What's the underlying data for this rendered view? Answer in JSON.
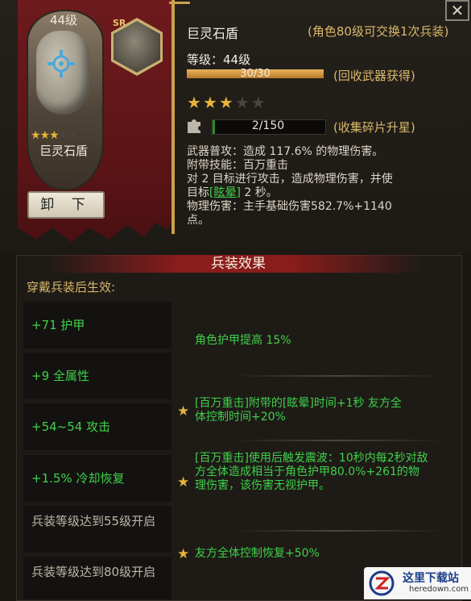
{
  "item": {
    "card_level": "44级",
    "rarity": "SR",
    "name": "巨灵石盾",
    "unequip_label": "卸 下",
    "exchange_note": "(角色80级可交换1次兵装)",
    "level_text": "等级：44级",
    "xp": {
      "text": "30/30",
      "current": 30,
      "max": 30
    },
    "xp_note": "(回收武器获得)",
    "stars": {
      "filled": 3,
      "total": 5
    },
    "fragments": {
      "text": "2/150",
      "current": 2,
      "max": 150
    },
    "fragments_note": "(收集碎片升星)",
    "description": {
      "line1": "武器普攻：造成 117.6% 的物理伤害。",
      "line2": "附带技能：百万重击",
      "line3": "对 2 目标进行攻击，造成物理伤害，并使",
      "line4_a": "目标",
      "line4_link": "[眩晕]",
      "line4_b": " 2 秒。",
      "line5": "物理伤害：主手基础伤害582.7%+1140",
      "line6": "点。"
    },
    "close_label": "✕"
  },
  "effects": {
    "title": "兵装效果",
    "subtitle": "穿戴兵装后生效:",
    "stats": [
      {
        "text": "+71 护甲",
        "active": true
      },
      {
        "text": "+9 全属性",
        "active": true
      },
      {
        "text": "+54~54 攻击",
        "active": true
      },
      {
        "text": "+1.5% 冷却恢复",
        "active": true
      },
      {
        "text": "兵装等级达到55级开启",
        "active": false
      },
      {
        "text": "兵装等级达到80级开启",
        "active": false
      }
    ],
    "bonuses": [
      {
        "text": "角色护甲提高 15%",
        "star": false
      },
      {
        "text": "[百万重击]附带的[眩晕]时间+1秒 友方全体控制时间+20%",
        "star": true
      },
      {
        "text": "[百万重击]使用后触发震波：10秒内每2秒对敌方全体造成相当于角色护甲80.0%+261的物理伤害，该伤害无视护甲。",
        "star": true
      },
      {
        "text": "友方全体控制恢复+50%",
        "star": true
      }
    ]
  },
  "watermark": {
    "title": "这里下载站",
    "url": "heredown.com"
  },
  "colors": {
    "accent_gold": "#d9b86a",
    "active_green": "#3fd04a",
    "banner_red": "#6e1a1d"
  }
}
